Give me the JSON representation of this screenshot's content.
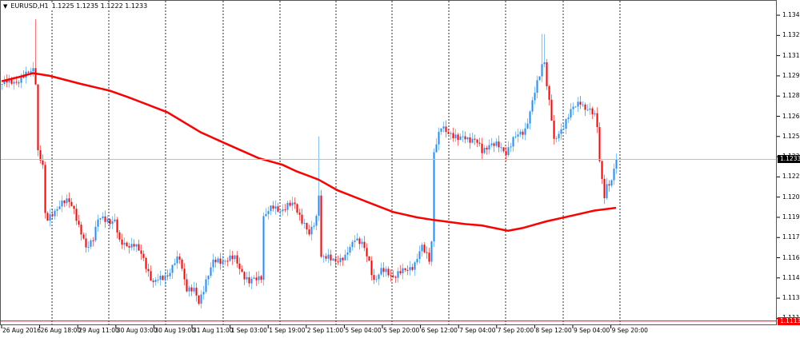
{
  "header": {
    "symbol": "EURUSD,H1",
    "ohlc": "1.1225 1.1235 1.1222 1.1233"
  },
  "colors": {
    "up": "#1e8fff",
    "down": "#ff0000",
    "ma": "#ff0000",
    "bid_line": "#c0c0c0",
    "grid": "#333333"
  },
  "chart_data": {
    "type": "candlestick",
    "title": "EURUSD,H1",
    "timeframe": "H1",
    "bars": 257,
    "ylim": [
      1.11099,
      1.13513
    ],
    "y_ticks": [
      "1.1340",
      "1.1325",
      "1.1310",
      "1.1295",
      "1.1280",
      "1.1265",
      "1.1250",
      "1.1235",
      "1.1220",
      "1.1205",
      "1.1190",
      "1.1175",
      "1.1160",
      "1.1145",
      "1.1130",
      "1.1115"
    ],
    "x_ticks": [
      "26 Aug 2016",
      "26 Aug 18:00",
      "29 Aug 11:00",
      "30 Aug 03:00",
      "30 Aug 19:00",
      "31 Aug 11:00",
      "1 Sep 03:00",
      "1 Sep 19:00",
      "2 Sep 11:00",
      "5 Sep 04:00",
      "5 Sep 20:00",
      "6 Sep 12:00",
      "7 Sep 04:00",
      "7 Sep 20:00",
      "8 Sep 12:00",
      "9 Sep 04:00",
      "9 Sep 20:00"
    ],
    "close_path": [
      [
        0,
        1.1289
      ],
      [
        7,
        1.1292
      ],
      [
        10,
        1.1295
      ],
      [
        13,
        1.1301
      ],
      [
        14,
        1.1292
      ],
      [
        15,
        1.1239
      ],
      [
        17,
        1.1227
      ],
      [
        18,
        1.1191
      ],
      [
        19,
        1.1188
      ],
      [
        21,
        1.1194
      ],
      [
        23,
        1.1197
      ],
      [
        28,
        1.1203
      ],
      [
        30,
        1.1197
      ],
      [
        32,
        1.1182
      ],
      [
        35,
        1.1167
      ],
      [
        38,
        1.1176
      ],
      [
        40,
        1.1188
      ],
      [
        47,
        1.1188
      ],
      [
        49,
        1.117
      ],
      [
        55,
        1.117
      ],
      [
        59,
        1.1159
      ],
      [
        63,
        1.1141
      ],
      [
        66,
        1.1144
      ],
      [
        70,
        1.115
      ],
      [
        72,
        1.1156
      ],
      [
        74,
        1.1159
      ],
      [
        77,
        1.1138
      ],
      [
        80,
        1.1135
      ],
      [
        82,
        1.1126
      ],
      [
        85,
        1.1144
      ],
      [
        88,
        1.1156
      ],
      [
        93,
        1.1159
      ],
      [
        97,
        1.1159
      ],
      [
        100,
        1.115
      ],
      [
        103,
        1.1141
      ],
      [
        108,
        1.1147
      ],
      [
        109,
        1.1191
      ],
      [
        113,
        1.1197
      ],
      [
        117,
        1.1196
      ],
      [
        122,
        1.12
      ],
      [
        125,
        1.1188
      ],
      [
        128,
        1.1176
      ],
      [
        131,
        1.1191
      ],
      [
        132,
        1.1209
      ],
      [
        133,
        1.1161
      ],
      [
        135,
        1.1159
      ],
      [
        143,
        1.1159
      ],
      [
        147,
        1.1176
      ],
      [
        150,
        1.117
      ],
      [
        153,
        1.1156
      ],
      [
        155,
        1.1144
      ],
      [
        158,
        1.115
      ],
      [
        163,
        1.1147
      ],
      [
        168,
        1.115
      ],
      [
        172,
        1.1156
      ],
      [
        175,
        1.1167
      ],
      [
        178,
        1.116
      ],
      [
        179,
        1.1173
      ],
      [
        180,
        1.1239
      ],
      [
        183,
        1.1256
      ],
      [
        187,
        1.1253
      ],
      [
        190,
        1.1247
      ],
      [
        193,
        1.125
      ],
      [
        197,
        1.1247
      ],
      [
        200,
        1.1239
      ],
      [
        203,
        1.1245
      ],
      [
        207,
        1.1242
      ],
      [
        210,
        1.1239
      ],
      [
        213,
        1.1247
      ],
      [
        218,
        1.1256
      ],
      [
        220,
        1.1268
      ],
      [
        223,
        1.1289
      ],
      [
        225,
        1.1304
      ],
      [
        226,
        1.1307
      ],
      [
        227,
        1.1289
      ],
      [
        229,
        1.1262
      ],
      [
        230,
        1.1245
      ],
      [
        233,
        1.1256
      ],
      [
        237,
        1.1268
      ],
      [
        241,
        1.1277
      ],
      [
        243,
        1.1271
      ],
      [
        247,
        1.1265
      ],
      [
        248,
        1.1259
      ],
      [
        249,
        1.1233
      ],
      [
        251,
        1.1206
      ],
      [
        252,
        1.1212
      ],
      [
        254,
        1.1215
      ],
      [
        255,
        1.1226
      ],
      [
        256,
        1.1233
      ]
    ],
    "spikes": [
      [
        14,
        1.1337
      ],
      [
        132,
        1.125
      ],
      [
        180,
        1.117
      ],
      [
        225,
        1.1326
      ],
      [
        226,
        1.1326
      ],
      [
        251,
        1.12
      ]
    ],
    "moving_average": [
      [
        0,
        1.1291
      ],
      [
        7,
        1.1294
      ],
      [
        13,
        1.1297
      ],
      [
        20,
        1.1295
      ],
      [
        33,
        1.1289
      ],
      [
        45,
        1.1284
      ],
      [
        53,
        1.1279
      ],
      [
        69,
        1.1268
      ],
      [
        83,
        1.1253
      ],
      [
        93,
        1.1245
      ],
      [
        107,
        1.1234
      ],
      [
        117,
        1.1229
      ],
      [
        123,
        1.1224
      ],
      [
        132,
        1.1218
      ],
      [
        140,
        1.121
      ],
      [
        150,
        1.1203
      ],
      [
        163,
        1.1194
      ],
      [
        173,
        1.119
      ],
      [
        180,
        1.1188
      ],
      [
        193,
        1.1185
      ],
      [
        200,
        1.1184
      ],
      [
        211,
        1.118
      ],
      [
        217,
        1.1182
      ],
      [
        227,
        1.1187
      ],
      [
        237,
        1.1191
      ],
      [
        247,
        1.1195
      ],
      [
        256,
        1.1197
      ]
    ],
    "bid": "1.1233",
    "level_line": "1.1113"
  }
}
